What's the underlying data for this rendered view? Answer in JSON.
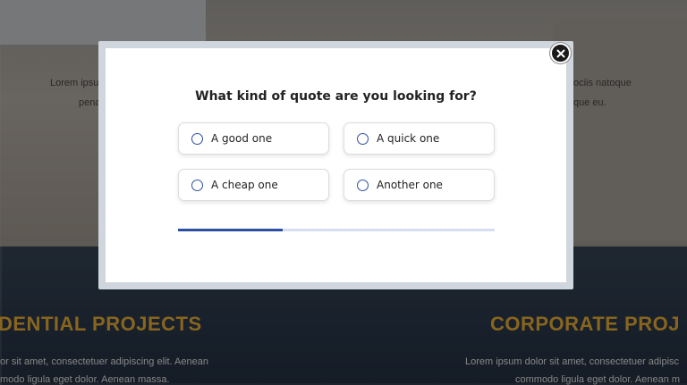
{
  "background": {
    "heading_partial": "",
    "intro_left_1": "Lorem ipsu",
    "intro_left_2": "pena",
    "intro_right_1": "ociis natoque",
    "intro_right_2": "que eu.",
    "projects": [
      {
        "title": "DENTIAL PROJECTS",
        "text_1": "or sit amet, consectetuer adipiscing elit. Aenean",
        "text_2": "modo ligula eget dolor. Aenean massa."
      },
      {
        "title": "CORPORATE PROJ",
        "text_1": "Lorem ipsum dolor sit amet, consectetuer adipisc",
        "text_2": "commodo ligula eget dolor. Aenean m"
      }
    ]
  },
  "modal": {
    "question": "What kind of quote are you looking for?",
    "options": [
      {
        "label": "A good one"
      },
      {
        "label": "A quick one"
      },
      {
        "label": "A cheap one"
      },
      {
        "label": "Another one"
      }
    ],
    "progress": 0.33,
    "colors": {
      "accent": "#2b4fa3",
      "track": "#d6def0"
    }
  }
}
